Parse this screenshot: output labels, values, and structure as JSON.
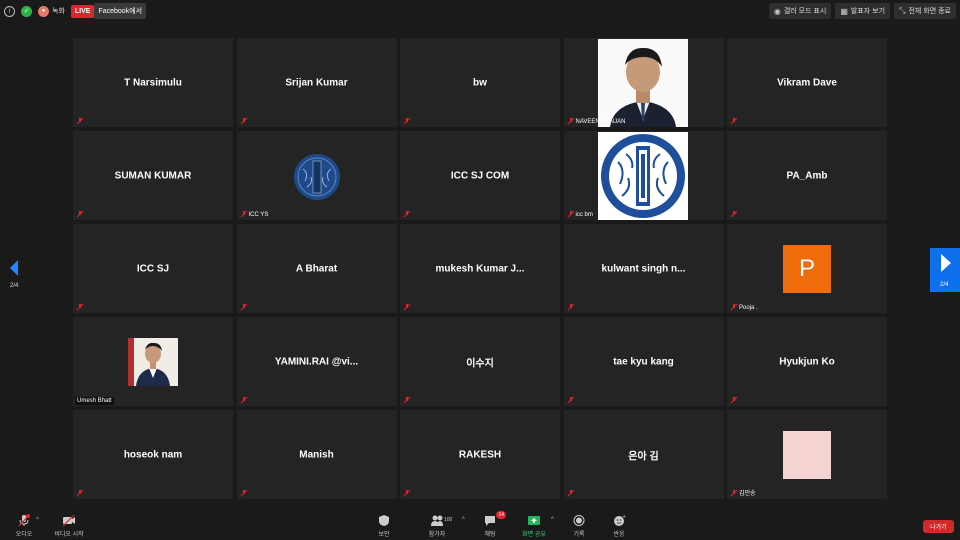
{
  "topbar": {
    "rec_label": "녹화",
    "live_label": "LIVE",
    "facebook_label": "Facebook에서",
    "gallery_btn": "갤러 모드 표시",
    "speaker_btn": "발표자 보기",
    "fullscreen_btn": "전체 화면 종료"
  },
  "tiles": [
    {
      "name": "T Narsimulu"
    },
    {
      "name": "Srijan Kumar"
    },
    {
      "name": "bw"
    },
    {
      "name": "NAVEEN RANJAN"
    },
    {
      "name": "Vikram Dave"
    },
    {
      "name": "SUMAN KUMAR"
    },
    {
      "name": "ICC YS"
    },
    {
      "name": "ICC SJ COM"
    },
    {
      "name": "icc bm"
    },
    {
      "name": "PA_Amb"
    },
    {
      "name": "ICC SJ"
    },
    {
      "name": "A Bharat"
    },
    {
      "name": "mukesh  Kumar  J..."
    },
    {
      "name": "kulwant  singh  n..."
    },
    {
      "name": "Pooja .",
      "avatar_letter": "P"
    },
    {
      "name": "Umesh Bhatt"
    },
    {
      "name": "YAMINI.RAI  @vi..."
    },
    {
      "name": "이수지"
    },
    {
      "name": "tae kyu kang"
    },
    {
      "name": "Hyukjun Ko"
    },
    {
      "name": "hoseok nam"
    },
    {
      "name": "Manish"
    },
    {
      "name": "RAKESH"
    },
    {
      "name": "은아 김"
    },
    {
      "name": "김민송"
    }
  ],
  "pagination": {
    "left": "2/4",
    "right": "2/4"
  },
  "bottombar": {
    "audio": "오디오",
    "video": "비디오 시작",
    "security": "보안",
    "participants": "참가자",
    "participants_count": "100",
    "chat": "채팅",
    "chat_badge": "14",
    "share": "화면 공유",
    "record": "기록",
    "reactions": "반응",
    "leave": "나가기"
  },
  "colors": {
    "accent": "#0e71eb",
    "live": "#e0242b",
    "avatar_orange": "#f06b0c",
    "leave": "#cf2a2a"
  },
  "icons": {
    "mic_off": "mic-off-icon",
    "video_off": "video-off-icon",
    "shield": "shield-icon"
  }
}
